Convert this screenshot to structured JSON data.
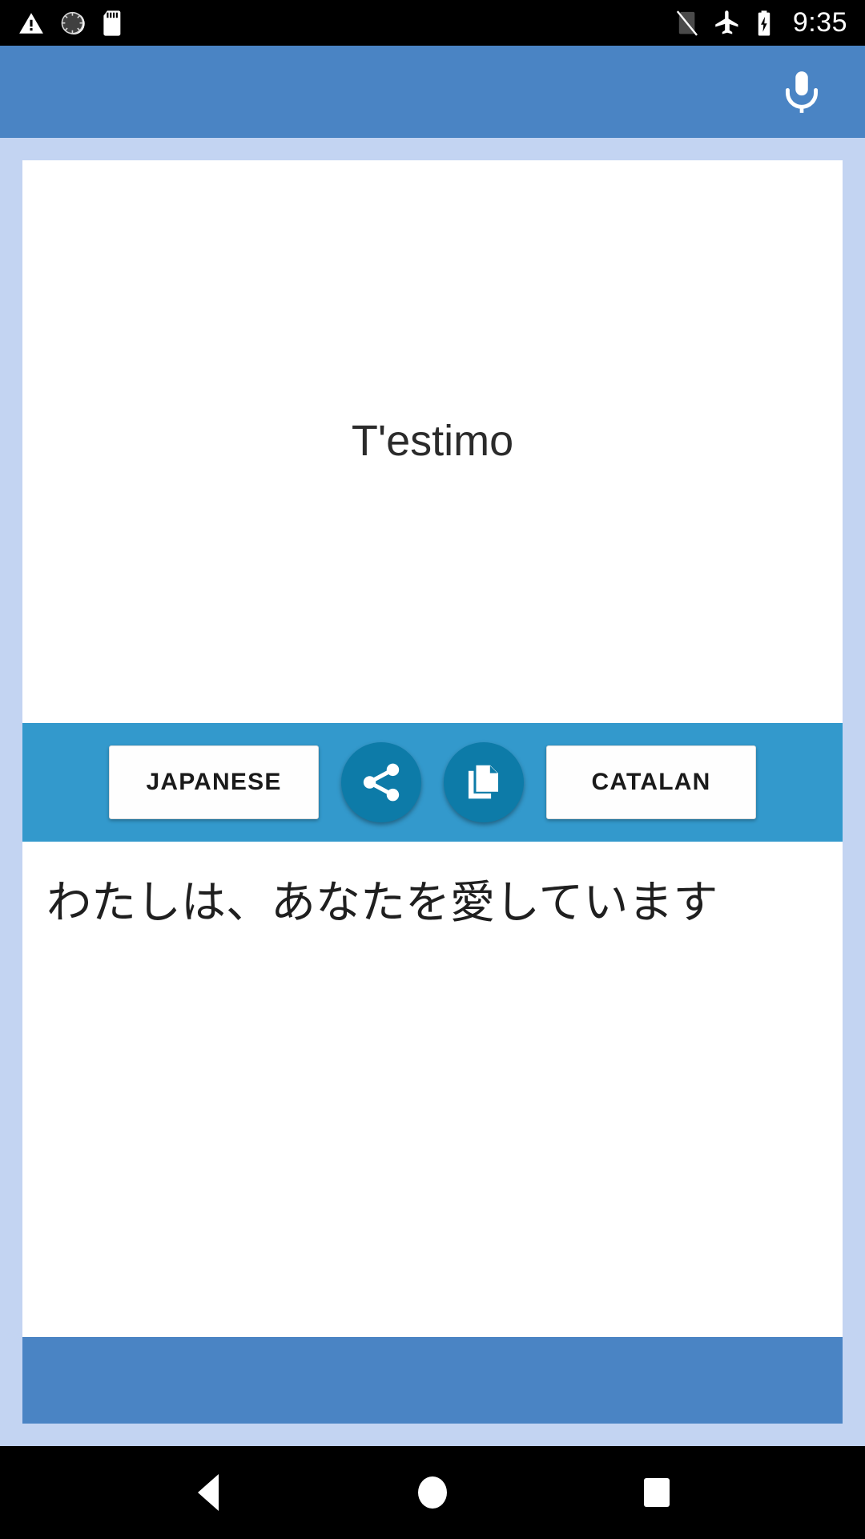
{
  "status_bar": {
    "icons_left": [
      "warning-triangle-icon",
      "clock-sync-icon",
      "sd-card-icon"
    ],
    "icons_right": [
      "no-sim-icon",
      "airplane-mode-icon",
      "battery-charging-icon"
    ],
    "time": "9:35"
  },
  "app_bar": {
    "mic_icon": "microphone-icon",
    "background_color": "#4a84c4"
  },
  "translation": {
    "source_text": "T'estimo",
    "target_text": "わたしは、あなたを愛しています"
  },
  "action_bar": {
    "background_color": "#3399cc",
    "target_language_button": "JAPANESE",
    "source_language_button": "CATALAN",
    "share_icon": "share-icon",
    "copy_icon": "copy-icon",
    "fab_color": "#0d7ba8"
  },
  "nav_bar": {
    "back": "back-triangle-icon",
    "home": "home-circle-icon",
    "recents": "recents-square-icon"
  },
  "colors": {
    "page_background": "#c3d4f2",
    "card_background": "#ffffff",
    "accent_blue": "#4a84c4",
    "toolbar_blue": "#3399cc"
  }
}
